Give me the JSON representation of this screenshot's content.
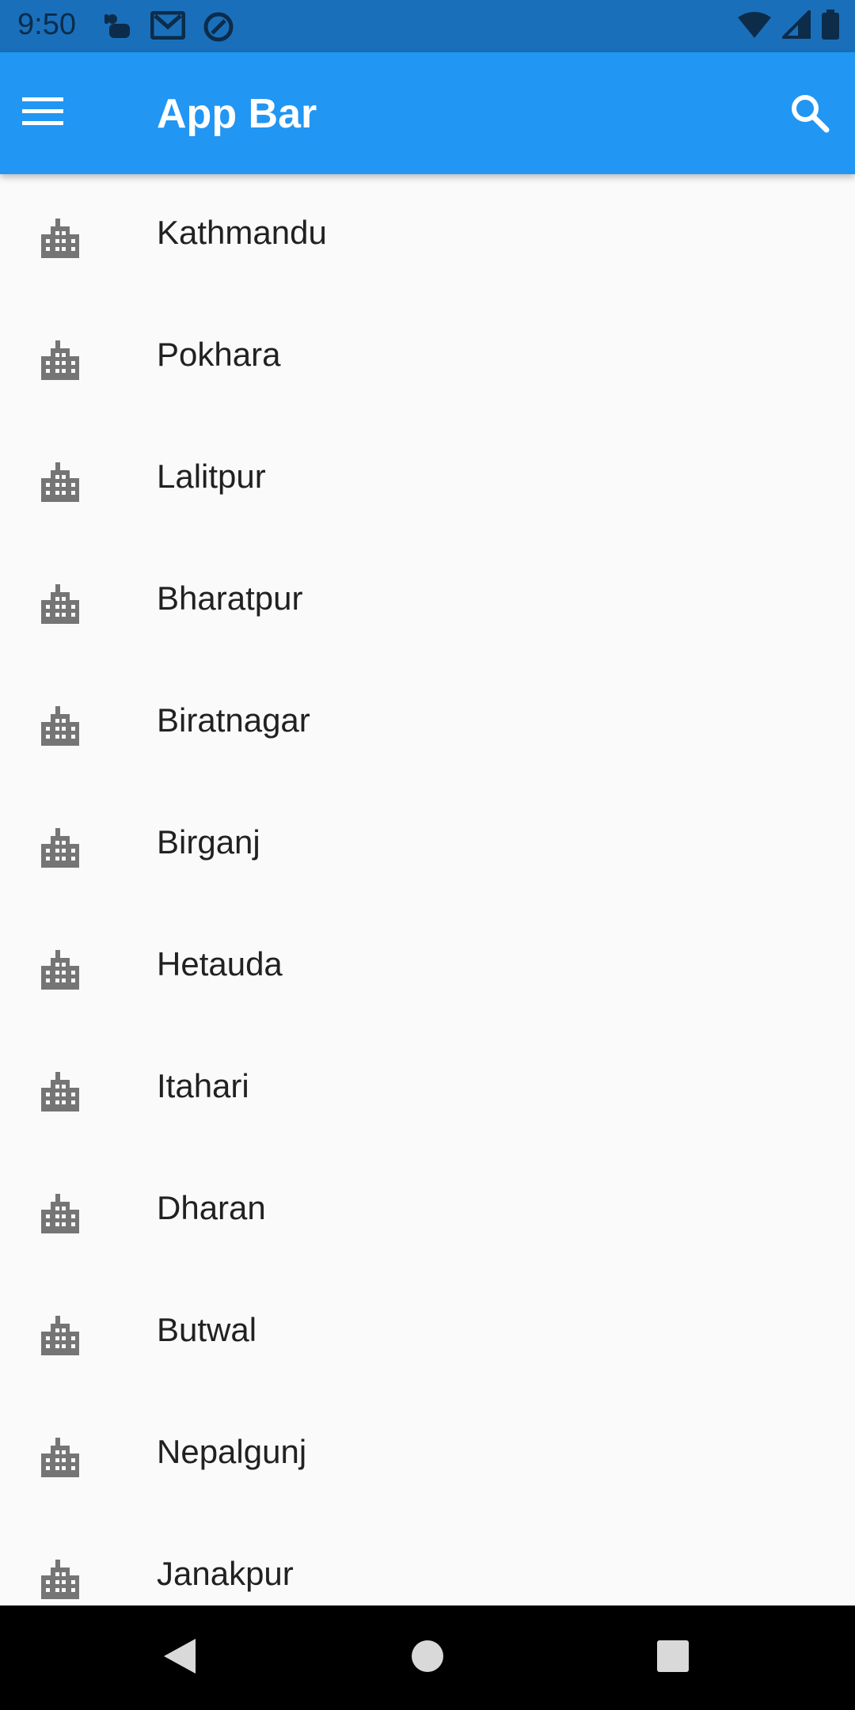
{
  "status_bar": {
    "time": "9:50",
    "left_icons": [
      "game-controller-icon",
      "gmail-icon",
      "data-saver-icon"
    ],
    "right_icons": [
      "wifi-icon",
      "cell-signal-icon",
      "battery-icon"
    ]
  },
  "app_bar": {
    "title": "App Bar",
    "menu_icon": "menu-icon",
    "search_icon": "search-icon"
  },
  "cities": [
    {
      "label": "Kathmandu",
      "icon": "city-icon"
    },
    {
      "label": "Pokhara",
      "icon": "city-icon"
    },
    {
      "label": "Lalitpur",
      "icon": "city-icon"
    },
    {
      "label": "Bharatpur",
      "icon": "city-icon"
    },
    {
      "label": "Biratnagar",
      "icon": "city-icon"
    },
    {
      "label": "Birganj",
      "icon": "city-icon"
    },
    {
      "label": "Hetauda",
      "icon": "city-icon"
    },
    {
      "label": "Itahari",
      "icon": "city-icon"
    },
    {
      "label": "Dharan",
      "icon": "city-icon"
    },
    {
      "label": "Butwal",
      "icon": "city-icon"
    },
    {
      "label": "Nepalgunj",
      "icon": "city-icon"
    },
    {
      "label": "Janakpur",
      "icon": "city-icon"
    }
  ],
  "nav_bar": {
    "buttons": [
      "back-icon",
      "home-icon",
      "recents-icon"
    ]
  },
  "colors": {
    "status_bar": "#1A6FBA",
    "app_bar": "#2196F3",
    "background": "#FAFAFA",
    "icon_gray": "#757575",
    "text": "#212121"
  }
}
